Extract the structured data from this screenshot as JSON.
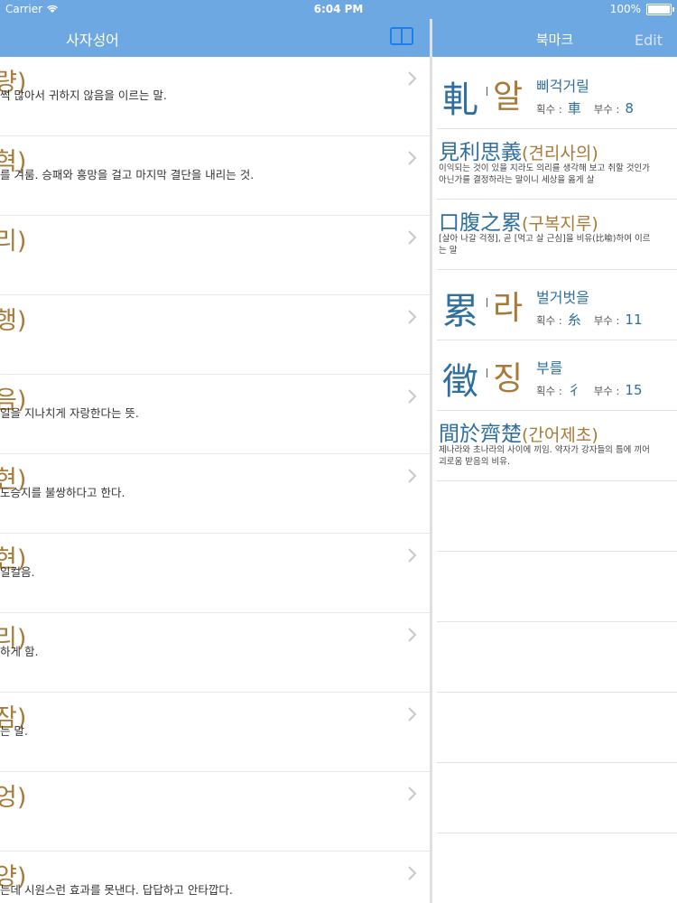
{
  "status": {
    "carrier": "Carrier",
    "time": "6:04 PM",
    "battery": "100%"
  },
  "left": {
    "title": "사자성어",
    "rows": [
      {
        "head": "량)",
        "desc": "썩 많아서 귀하지 않음을 이르는 말."
      },
      {
        "head": "혁)",
        "desc": "를 겨룸. 승패와 흥망을 걸고 마지막 결단을 내리는 것."
      },
      {
        "head": "리)",
        "desc": ""
      },
      {
        "head": "행)",
        "desc": ""
      },
      {
        "head": "음)",
        "desc": "일을 지나치게 자랑한다는 뜻."
      },
      {
        "head": "현)",
        "desc": "도승지를 불쌍하다고 한다."
      },
      {
        "head": "현)",
        "desc": "일컬음."
      },
      {
        "head": "리)",
        "desc": "하게 함."
      },
      {
        "head": "잠)",
        "desc": "는 말."
      },
      {
        "head": "엉)",
        "desc": ""
      },
      {
        "head": "양)",
        "desc": "는데 시원스런 효과를 못낸다. 답답하고 안타깝다."
      }
    ]
  },
  "right": {
    "title": "북마크",
    "edit": "Edit",
    "bookmarks": [
      {
        "kind": "char",
        "han": "軋",
        "sound": "알",
        "meaning": "삐걱거릴",
        "strokes_label": "획수 :",
        "strokes": "車",
        "radical_label": "부수 :",
        "radical": "8"
      },
      {
        "kind": "idiom",
        "han": "見利思義",
        "reading": "(견리사의)",
        "text": "이익되는 것이 있을 지라도 의리를 생각해 보고 취할 것인가 아닌가를 결정하라는 말이니 세상을 옳게 살"
      },
      {
        "kind": "idiom",
        "han": "口腹之累",
        "reading": "(구복지루)",
        "text": "[살아 나갈 걱정], 곧 [먹고 살 근심]을 비유(比喩)하여 이르는 말"
      },
      {
        "kind": "char",
        "han": "累",
        "sound": "라",
        "meaning": "벌거벗을",
        "strokes_label": "획수 :",
        "strokes": "糸",
        "radical_label": "부수 :",
        "radical": "11"
      },
      {
        "kind": "char",
        "han": "徵",
        "sound": "징",
        "meaning": "부를",
        "strokes_label": "획수 :",
        "strokes": "彳",
        "radical_label": "부수 :",
        "radical": "15"
      },
      {
        "kind": "idiom",
        "han": "間於齊楚",
        "reading": "(간어제초)",
        "text": "제나라와 초나라의 사이에 끼임. 약자가 강자들의 틈에 끼어 괴로움 받음의 비유."
      }
    ]
  },
  "colors": {
    "nav": "#6ea8e2",
    "blue": "#2f6f9f",
    "brown": "#a87a38"
  }
}
